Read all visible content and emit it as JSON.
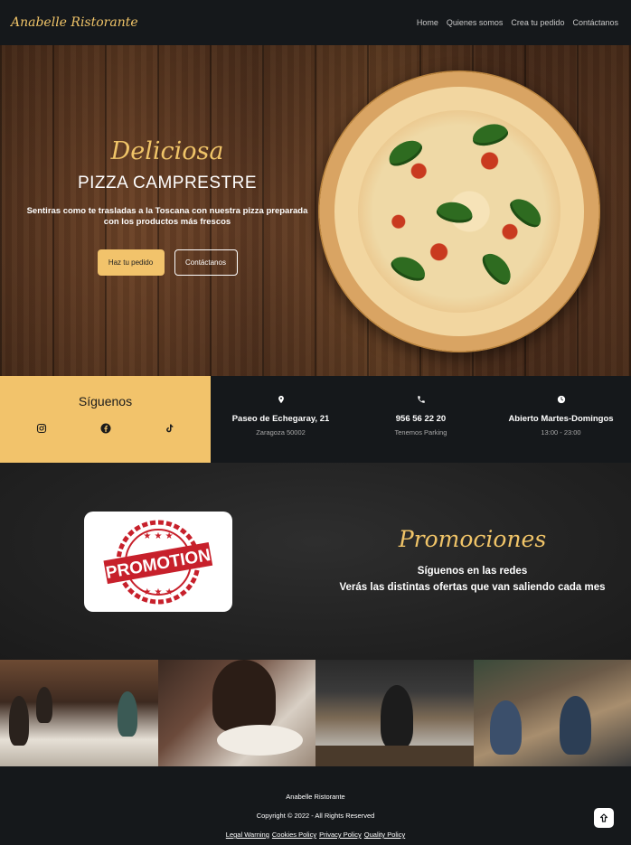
{
  "nav": {
    "brand": "Anabelle Ristorante",
    "items": [
      "Home",
      "Quienes somos",
      "Crea tu pedido",
      "Contáctanos"
    ]
  },
  "hero": {
    "script": "Deliciosa",
    "title": "PIZZA CAMPRESTRE",
    "text": "Sentiras como te trasladas a la Toscana con nuestra pizza preparada con los productos más frescos",
    "primary_button": "Haz tu pedido",
    "secondary_button": "Contáctanos"
  },
  "follow": {
    "title": "Síguenos",
    "icons": [
      "instagram-icon",
      "facebook-icon",
      "tiktok-icon"
    ]
  },
  "info": [
    {
      "icon": "location-pin-icon",
      "main": "Paseo de Echegaray, 21",
      "sub": "Zaragoza 50002"
    },
    {
      "icon": "phone-icon",
      "main": "956 56 22 20",
      "sub": "Tenemos Parking"
    },
    {
      "icon": "clock-icon",
      "main": "Abierto Martes-Domingos",
      "sub": "13:00 - 23:00"
    }
  ],
  "promo": {
    "badge_text": "PROMOTION",
    "title": "Promociones",
    "line1": "Síguenos en las redes",
    "line2": "Verás las distintas ofertas que van saliendo cada mes"
  },
  "footer": {
    "name": "Anabelle Ristorante",
    "copyright": "Copyright © 2022 - All Rights Reserved",
    "links": [
      "Legal Warning",
      "Cookies Policy",
      "Privacy Policy",
      "Quality Policy"
    ]
  },
  "colors": {
    "accent": "#f2c36b",
    "dark": "#15181b",
    "promo_red": "#c7202b"
  }
}
